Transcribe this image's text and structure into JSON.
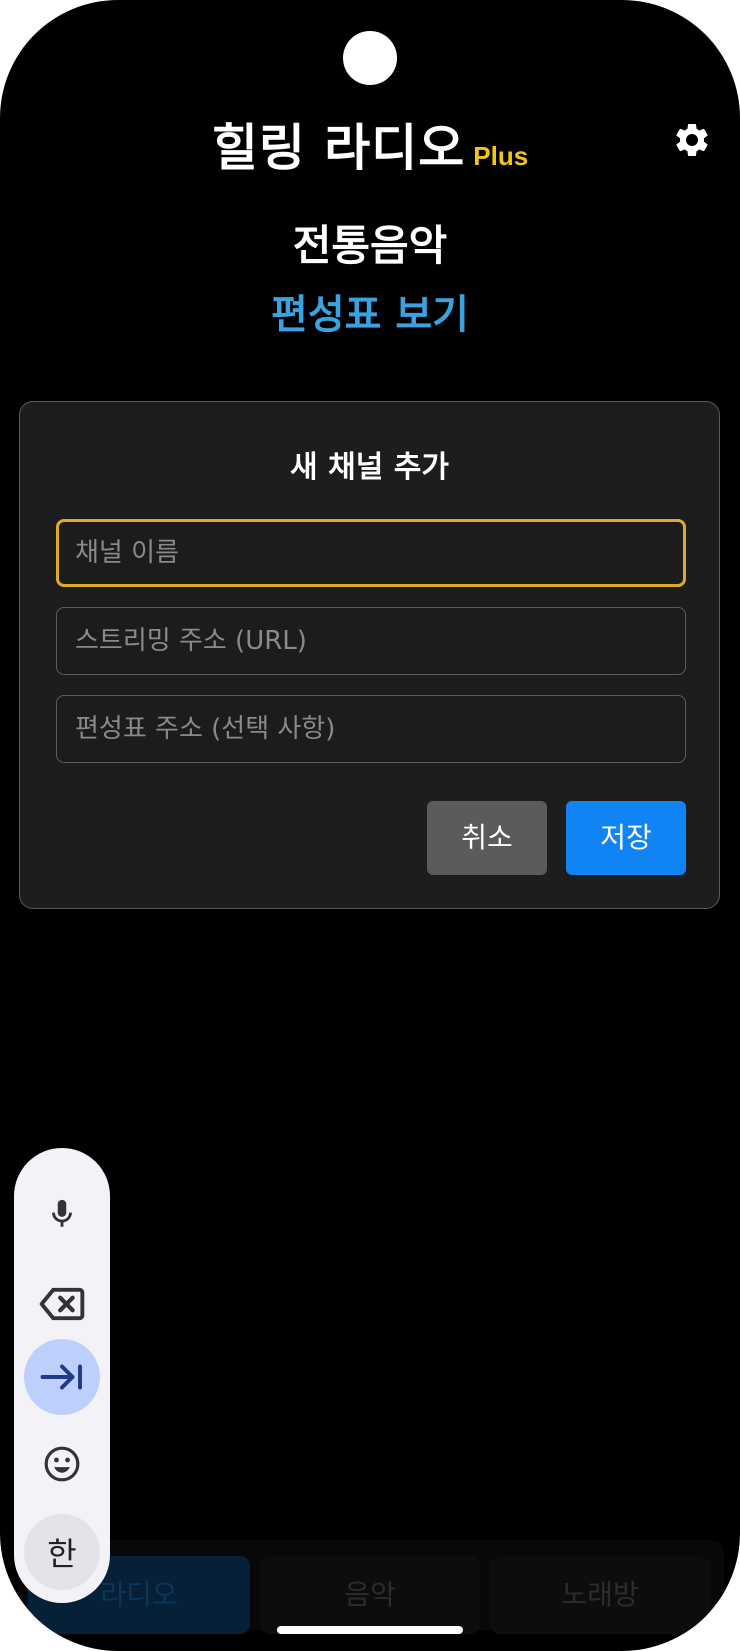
{
  "header": {
    "title": "힐링 라디오",
    "badge": "Plus",
    "settings_icon": "gear-icon"
  },
  "current_channel": {
    "name": "전통음악",
    "schedule_link": "편성표 보기"
  },
  "dialog": {
    "title": "새 채널 추가",
    "fields": {
      "name": {
        "placeholder": "채널 이름",
        "value": ""
      },
      "stream_url": {
        "placeholder": "스트리밍 주소 (URL)",
        "value": ""
      },
      "schedule_url": {
        "placeholder": "편성표 주소 (선택 사항)",
        "value": ""
      }
    },
    "cancel_label": "취소",
    "save_label": "저장"
  },
  "bottom_nav": {
    "tabs": [
      {
        "label": "라디오",
        "active": true
      },
      {
        "label": "음악",
        "active": false
      },
      {
        "label": "노래방",
        "active": false
      }
    ]
  },
  "keyboard_toolbar": {
    "items": [
      "microphone-icon",
      "backspace-icon",
      "tab-icon",
      "emoji-icon"
    ],
    "language_label": "한"
  },
  "colors": {
    "accent_yellow": "#f2c51b",
    "link_blue": "#3aa2de",
    "save_blue": "#1184f5",
    "focus_border": "#e0a92a"
  }
}
